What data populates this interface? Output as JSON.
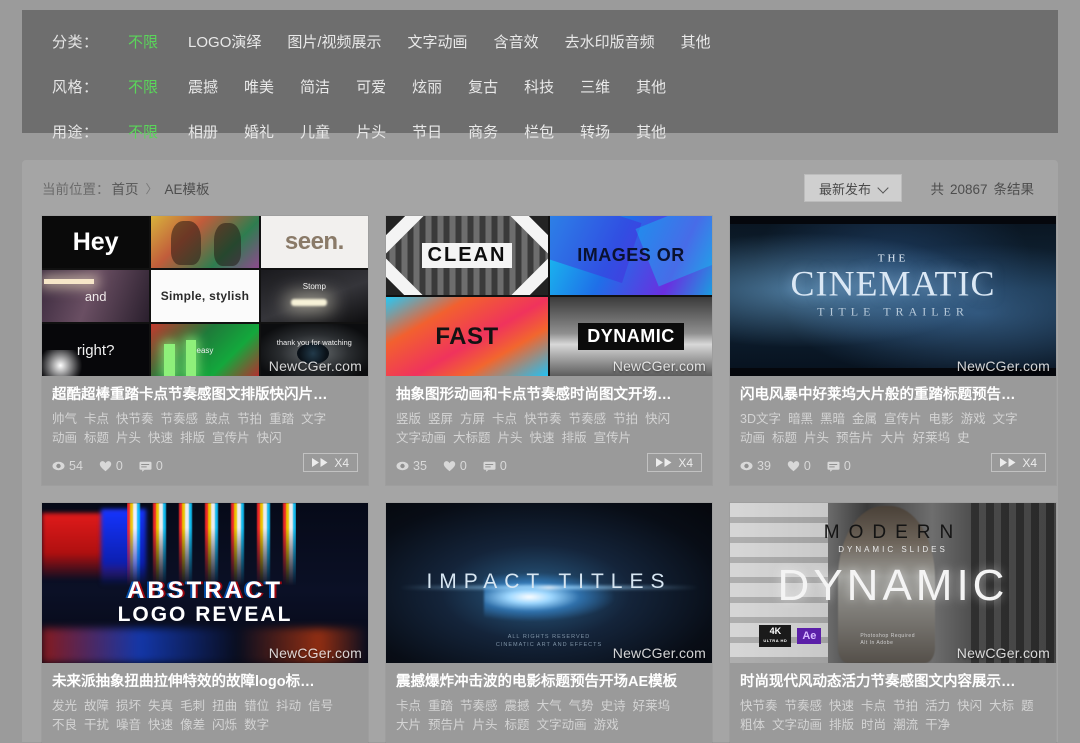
{
  "filters": [
    {
      "name": "category",
      "label": "分类：",
      "options": [
        "不限",
        "LOGO演绎",
        "图片/视频展示",
        "文字动画",
        "含音效",
        "去水印版音频",
        "其他"
      ],
      "active_index": 0
    },
    {
      "name": "style",
      "label": "风格：",
      "options": [
        "不限",
        "震撼",
        "唯美",
        "简洁",
        "可爱",
        "炫丽",
        "复古",
        "科技",
        "三维",
        "其他"
      ],
      "active_index": 0
    },
    {
      "name": "usage",
      "label": "用途：",
      "options": [
        "不限",
        "相册",
        "婚礼",
        "儿童",
        "片头",
        "节日",
        "商务",
        "栏包",
        "转场",
        "其他"
      ],
      "active_index": 0
    }
  ],
  "breadcrumb": {
    "prefix": "当前位置：",
    "home": "首页",
    "separator": "〉",
    "current": "AE模板"
  },
  "sort": {
    "selected": "最新发布",
    "icon": "chevron-down-icon"
  },
  "results": {
    "prefix": "共",
    "count": "20867",
    "suffix": "条结果"
  },
  "watermark": "NewCGer.com",
  "cards": [
    {
      "title": "超酷超棒重踏卡点节奏感图文排版快闪片…",
      "tags": [
        "帅气",
        "卡点",
        "快节奏",
        "节奏感",
        "鼓点",
        "节拍",
        "重踏",
        "文字",
        "动画",
        "标题",
        "片头",
        "快速",
        "排版",
        "宣传片",
        "快闪"
      ],
      "views": "54",
      "likes": "0",
      "comments": "0",
      "badge": "X4",
      "thumb_texts": {
        "hey": "Hey",
        "seen": "seen.",
        "and": "and",
        "simple": "Simple, stylish",
        "stomp": "Stomp",
        "right": "right?",
        "thanks": "thank you for watching",
        "easy": "easy"
      }
    },
    {
      "title": "抽象图形动画和卡点节奏感时尚图文开场…",
      "tags": [
        "竖版",
        "竖屏",
        "方屏",
        "卡点",
        "快节奏",
        "节奏感",
        "节拍",
        "快闪",
        "文字动画",
        "大标题",
        "片头",
        "快速",
        "排版",
        "宣传片"
      ],
      "views": "35",
      "likes": "0",
      "comments": "0",
      "badge": "X4",
      "thumb_texts": {
        "clean": "CLEAN",
        "images": "IMAGES OR",
        "fast": "FAST",
        "dynamic": "DYNAMIC"
      }
    },
    {
      "title": "闪电风暴中好莱坞大片般的重踏标题预告…",
      "tags": [
        "3D文字",
        "暗黑",
        "黑暗",
        "金属",
        "宣传片",
        "电影",
        "游戏",
        "文字",
        "动画",
        "标题",
        "片头",
        "预告片",
        "大片",
        "好莱坞",
        "史"
      ],
      "views": "39",
      "likes": "0",
      "comments": "0",
      "badge": "X4",
      "thumb_texts": {
        "the": "THE",
        "main": "CINEMATIC",
        "sub": "TITLE TRAILER"
      }
    },
    {
      "title": "未来派抽象扭曲拉伸特效的故障logo标…",
      "tags": [
        "发光",
        "故障",
        "损坏",
        "失真",
        "毛刺",
        "扭曲",
        "错位",
        "抖动",
        "信号",
        "不良",
        "干扰",
        "噪音",
        "快速",
        "像差",
        "闪烁",
        "数字"
      ],
      "views": "",
      "likes": "",
      "comments": "",
      "badge": "",
      "thumb_texts": {
        "line1": "ABSTRACT",
        "line2": "LOGO REVEAL"
      }
    },
    {
      "title": "震撼爆炸冲击波的电影标题预告开场AE模板",
      "tags": [
        "卡点",
        "重踏",
        "节奏感",
        "震撼",
        "大气",
        "气势",
        "史诗",
        "好莱坞",
        "大片",
        "预告片",
        "片头",
        "标题",
        "文字动画",
        "游戏"
      ],
      "views": "",
      "likes": "",
      "comments": "",
      "badge": "",
      "thumb_texts": {
        "main": "IMPACT TITLES",
        "fine1": "ALL RIGHTS RESERVED",
        "fine2": "CINEMATIC ART AND EFFECTS"
      }
    },
    {
      "title": "时尚现代风动态活力节奏感图文内容展示…",
      "tags": [
        "快节奏",
        "节奏感",
        "快速",
        "卡点",
        "节拍",
        "活力",
        "快闪",
        "大标",
        "题",
        "粗体",
        "文字动画",
        "排版",
        "时尚",
        "潮流",
        "干净"
      ],
      "views": "",
      "likes": "",
      "comments": "",
      "badge": "",
      "thumb_texts": {
        "top": "MODERN",
        "mid": "DYNAMIC SLIDES",
        "big": "DYNAMIC",
        "badge_4k": "4K",
        "badge_4k_sub": "ULTRA HD",
        "badge_ae": "Ae",
        "fine1": "Photoshop Required",
        "fine2": "Alt In Adobe"
      }
    }
  ]
}
